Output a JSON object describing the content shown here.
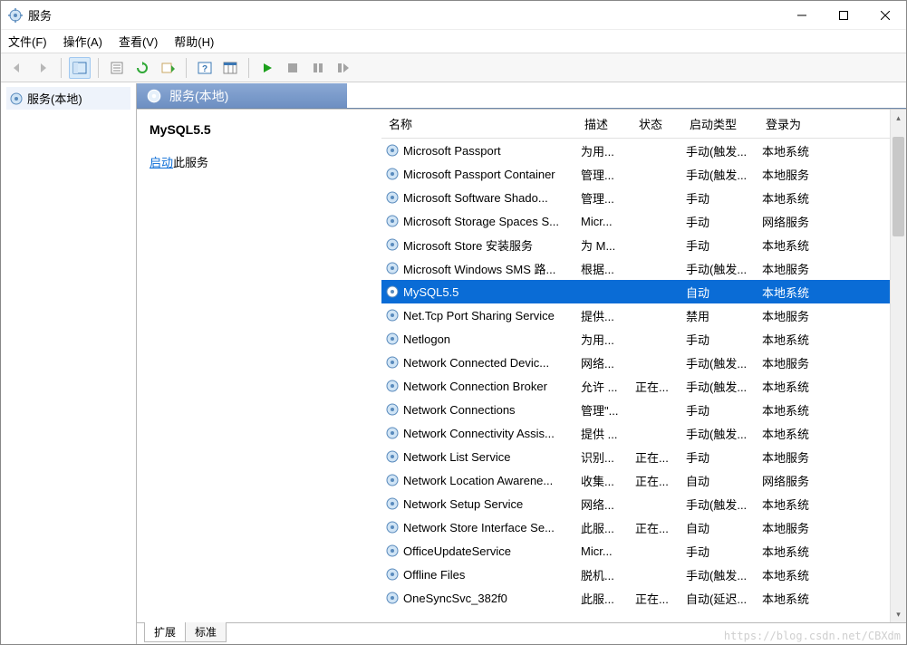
{
  "title": "服务",
  "menu": [
    "文件(F)",
    "操作(A)",
    "查看(V)",
    "帮助(H)"
  ],
  "nav": {
    "root": "服务(本地)"
  },
  "panel_header": "服务(本地)",
  "selected_service": {
    "name": "MySQL5.5",
    "action_prefix": "启动",
    "action_suffix": "此服务"
  },
  "columns": [
    "名称",
    "描述",
    "状态",
    "启动类型",
    "登录为"
  ],
  "rows": [
    {
      "name": "Microsoft Passport",
      "desc": "为用...",
      "status": "",
      "startup": "手动(触发...",
      "logon": "本地系统",
      "selected": false
    },
    {
      "name": "Microsoft Passport Container",
      "desc": "管理...",
      "status": "",
      "startup": "手动(触发...",
      "logon": "本地服务",
      "selected": false
    },
    {
      "name": "Microsoft Software Shado...",
      "desc": "管理...",
      "status": "",
      "startup": "手动",
      "logon": "本地系统",
      "selected": false
    },
    {
      "name": "Microsoft Storage Spaces S...",
      "desc": "Micr...",
      "status": "",
      "startup": "手动",
      "logon": "网络服务",
      "selected": false
    },
    {
      "name": "Microsoft Store 安装服务",
      "desc": "为 M...",
      "status": "",
      "startup": "手动",
      "logon": "本地系统",
      "selected": false
    },
    {
      "name": "Microsoft Windows SMS 路...",
      "desc": "根据...",
      "status": "",
      "startup": "手动(触发...",
      "logon": "本地服务",
      "selected": false
    },
    {
      "name": "MySQL5.5",
      "desc": "",
      "status": "",
      "startup": "自动",
      "logon": "本地系统",
      "selected": true
    },
    {
      "name": "Net.Tcp Port Sharing Service",
      "desc": "提供...",
      "status": "",
      "startup": "禁用",
      "logon": "本地服务",
      "selected": false
    },
    {
      "name": "Netlogon",
      "desc": "为用...",
      "status": "",
      "startup": "手动",
      "logon": "本地系统",
      "selected": false
    },
    {
      "name": "Network Connected Devic...",
      "desc": "网络...",
      "status": "",
      "startup": "手动(触发...",
      "logon": "本地服务",
      "selected": false
    },
    {
      "name": "Network Connection Broker",
      "desc": "允许 ...",
      "status": "正在...",
      "startup": "手动(触发...",
      "logon": "本地系统",
      "selected": false
    },
    {
      "name": "Network Connections",
      "desc": "管理\"...",
      "status": "",
      "startup": "手动",
      "logon": "本地系统",
      "selected": false
    },
    {
      "name": "Network Connectivity Assis...",
      "desc": "提供 ...",
      "status": "",
      "startup": "手动(触发...",
      "logon": "本地系统",
      "selected": false
    },
    {
      "name": "Network List Service",
      "desc": "识别...",
      "status": "正在...",
      "startup": "手动",
      "logon": "本地服务",
      "selected": false
    },
    {
      "name": "Network Location Awarene...",
      "desc": "收集...",
      "status": "正在...",
      "startup": "自动",
      "logon": "网络服务",
      "selected": false
    },
    {
      "name": "Network Setup Service",
      "desc": "网络...",
      "status": "",
      "startup": "手动(触发...",
      "logon": "本地系统",
      "selected": false
    },
    {
      "name": "Network Store Interface Se...",
      "desc": "此服...",
      "status": "正在...",
      "startup": "自动",
      "logon": "本地服务",
      "selected": false
    },
    {
      "name": "OfficeUpdateService",
      "desc": "Micr...",
      "status": "",
      "startup": "手动",
      "logon": "本地系统",
      "selected": false
    },
    {
      "name": "Offline Files",
      "desc": "脱机...",
      "status": "",
      "startup": "手动(触发...",
      "logon": "本地系统",
      "selected": false
    },
    {
      "name": "OneSyncSvc_382f0",
      "desc": "此服...",
      "status": "正在...",
      "startup": "自动(延迟...",
      "logon": "本地系统",
      "selected": false
    }
  ],
  "tabs": [
    "扩展",
    "标准"
  ],
  "active_tab": 0,
  "watermark": "https://blog.csdn.net/CBXdm"
}
